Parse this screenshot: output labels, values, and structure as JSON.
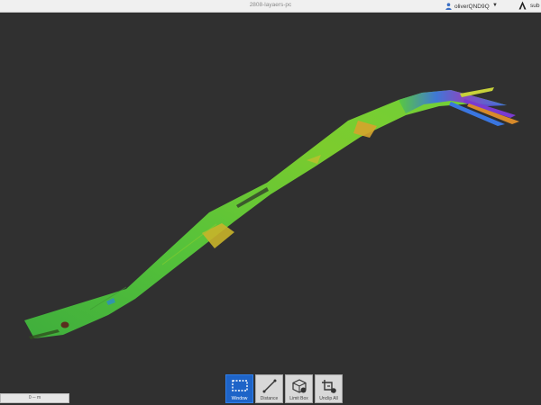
{
  "window": {
    "title": "2808-layaers-pc"
  },
  "user": {
    "name": "oliverQND9Q"
  },
  "brand": {
    "label": "sub"
  },
  "toolbar": {
    "tools": [
      {
        "label": "Window",
        "icon": "window-select-icon",
        "active": true
      },
      {
        "label": "Distance",
        "icon": "distance-icon",
        "active": false
      },
      {
        "label": "Limit Box",
        "icon": "limit-box-icon",
        "active": false
      },
      {
        "label": "Unclip All",
        "icon": "unclip-icon",
        "active": false
      }
    ]
  },
  "scale_bar": {
    "text": "0 ─ m"
  }
}
